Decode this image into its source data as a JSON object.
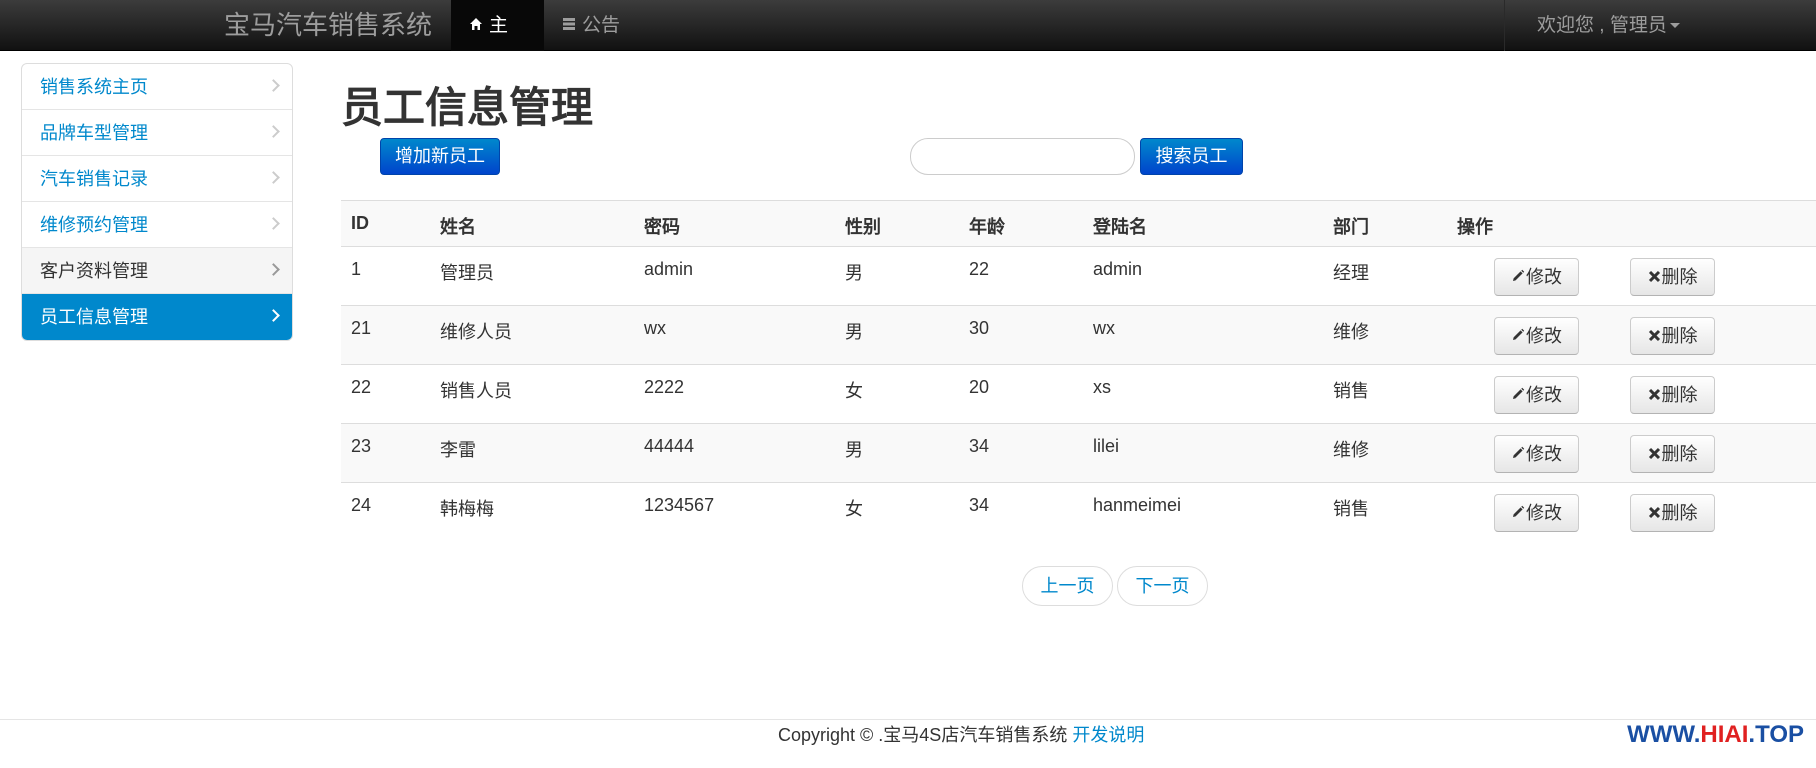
{
  "navbar": {
    "brand": "宝马汽车销售系统",
    "home_label": "主页",
    "notice_label": "公告",
    "user_label": "欢迎您 , 管理员"
  },
  "sidebar": {
    "items": [
      {
        "label": "销售系统主页"
      },
      {
        "label": "品牌车型管理"
      },
      {
        "label": "汽车销售记录"
      },
      {
        "label": "维修预约管理"
      },
      {
        "label": "客户资料管理"
      },
      {
        "label": "员工信息管理"
      }
    ],
    "active_index": 5
  },
  "main": {
    "title": "员工信息管理",
    "add_button": "增加新员工",
    "search_placeholder": "",
    "search_value": "",
    "search_button": "搜索员工"
  },
  "table": {
    "headers": [
      "ID",
      "姓名",
      "密码",
      "性别",
      "年龄",
      "登陆名",
      "部门",
      "操作"
    ],
    "rows": [
      [
        "1",
        "管理员",
        "admin",
        "男",
        "22",
        "admin",
        "经理"
      ],
      [
        "21",
        "维修人员",
        "wx",
        "男",
        "30",
        "wx",
        "维修"
      ],
      [
        "22",
        "销售人员",
        "2222",
        "女",
        "20",
        "xs",
        "销售"
      ],
      [
        "23",
        "李雷",
        "44444",
        "男",
        "34",
        "lilei",
        "维修"
      ],
      [
        "24",
        "韩梅梅",
        "1234567",
        "女",
        "34",
        "hanmeimei",
        "销售"
      ]
    ],
    "edit_label": "修改",
    "delete_label": "删除"
  },
  "pager": {
    "prev_label": "上一页",
    "next_label": "下一页"
  },
  "footer": {
    "copyright": "Copyright © .宝马4S店汽车销售系统 ",
    "link_label": "开发说明"
  },
  "watermark": {
    "part1": "WWW.",
    "part2": "HIAI",
    "part3": ".TOP"
  },
  "colors": {
    "accent": "#0088cc",
    "navbar": "#222222"
  }
}
